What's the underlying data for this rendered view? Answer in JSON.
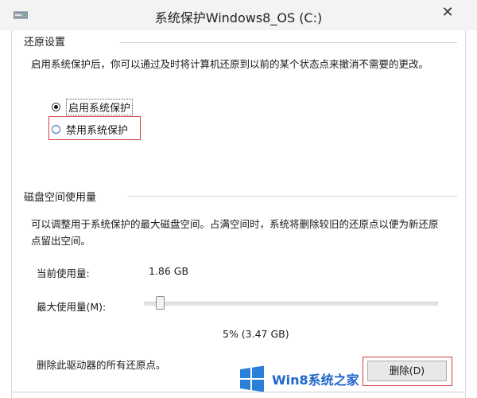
{
  "window": {
    "title": "系统保护Windows8_OS (C:)",
    "close_glyph": "✕"
  },
  "restore_settings": {
    "title": "还原设置",
    "description": "启用系统保护后，你可以通过及时将计算机还原到以前的某个状态点来撤消不需要的更改。",
    "options": [
      {
        "label": "启用系统保护",
        "selected": true
      },
      {
        "label": "禁用系统保护",
        "selected": false
      }
    ]
  },
  "disk_usage": {
    "title": "磁盘空间使用量",
    "description": "可以调整用于系统保护的最大磁盘空间。占满空间时，系统将删除较旧的还原点以便为新还原点留出空间。",
    "current_label": "当前使用量:",
    "current_value": "1.86 GB",
    "max_label": "最大使用量(M):",
    "slider_percent": 5,
    "slider_value_text": "5% (3.47 GB)"
  },
  "delete_section": {
    "description": "删除此驱动器的所有还原点。",
    "button_label": "删除(D)"
  },
  "watermark": {
    "text": "Win8系统之家"
  },
  "colors": {
    "highlight_box": "#d53b3b",
    "watermark_blue": "#1f66c9"
  }
}
